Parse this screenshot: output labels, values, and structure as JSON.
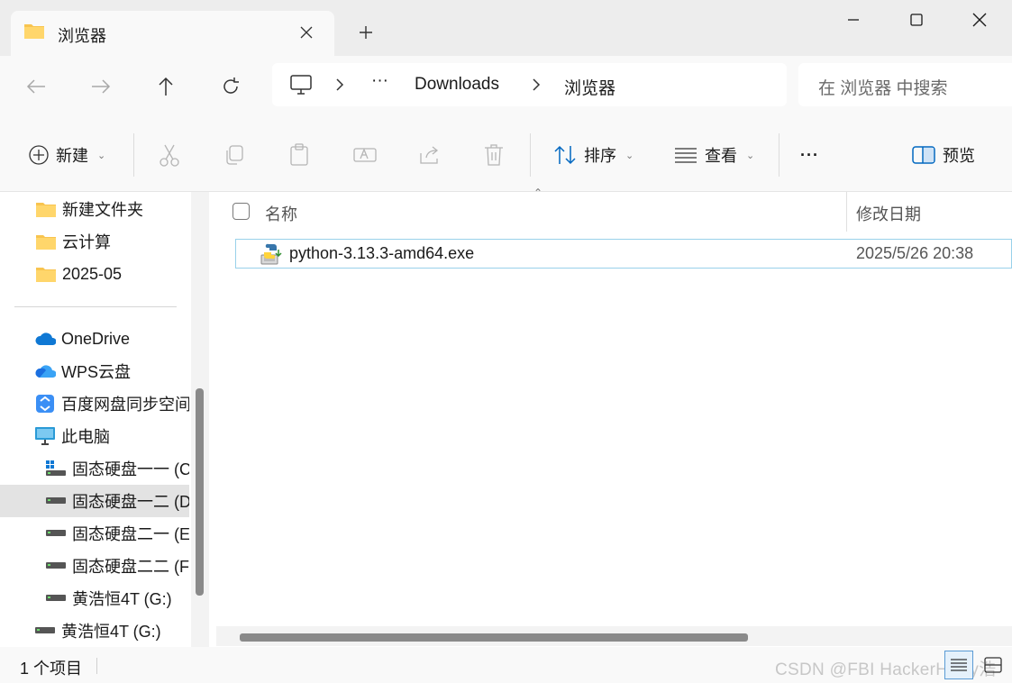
{
  "window": {
    "tab_title": "浏览器",
    "controls": [
      "minimize",
      "maximize",
      "close"
    ]
  },
  "navigation": {
    "breadcrumb": [
      "Downloads",
      "浏览器"
    ],
    "overflow": "···",
    "search_placeholder": "在 浏览器 中搜索"
  },
  "toolbar": {
    "new_label": "新建",
    "sort_label": "排序",
    "view_label": "查看",
    "more_label": "···",
    "preview_label": "预览"
  },
  "sidebar": {
    "items": [
      {
        "label": "新建文件夹",
        "icon": "folder-icon"
      },
      {
        "label": "云计算",
        "icon": "folder-icon"
      },
      {
        "label": "2025-05",
        "icon": "folder-icon"
      },
      {
        "label": "OneDrive",
        "icon": "onedrive-icon"
      },
      {
        "label": "WPS云盘",
        "icon": "wps-cloud-icon"
      },
      {
        "label": "百度网盘同步空间",
        "icon": "baidu-netdisk-icon"
      },
      {
        "label": "此电脑",
        "icon": "this-pc-icon"
      },
      {
        "label": "固态硬盘一一 (C:)",
        "icon": "system-drive-icon"
      },
      {
        "label": "固态硬盘一二 (D:)",
        "icon": "drive-icon",
        "selected": true
      },
      {
        "label": "固态硬盘二一 (E:)",
        "icon": "drive-icon"
      },
      {
        "label": "固态硬盘二二 (F:)",
        "icon": "drive-icon"
      },
      {
        "label": "黄浩恒4T (G:)",
        "icon": "drive-icon"
      },
      {
        "label": "黄浩恒4T (G:)",
        "icon": "drive-icon"
      }
    ]
  },
  "file_list": {
    "columns": [
      "名称",
      "修改日期"
    ],
    "rows": [
      {
        "name": "python-3.13.3-amd64.exe",
        "modified": "2025/5/26 20:38",
        "icon": "python-installer-icon"
      }
    ]
  },
  "status": {
    "item_count": "1 个项目"
  },
  "watermark": "CSDN @FBI HackerHarry浩",
  "colors": {
    "folder": "#f8c44f",
    "selection_border": "#99d1ea",
    "accent": "#0067c0"
  }
}
